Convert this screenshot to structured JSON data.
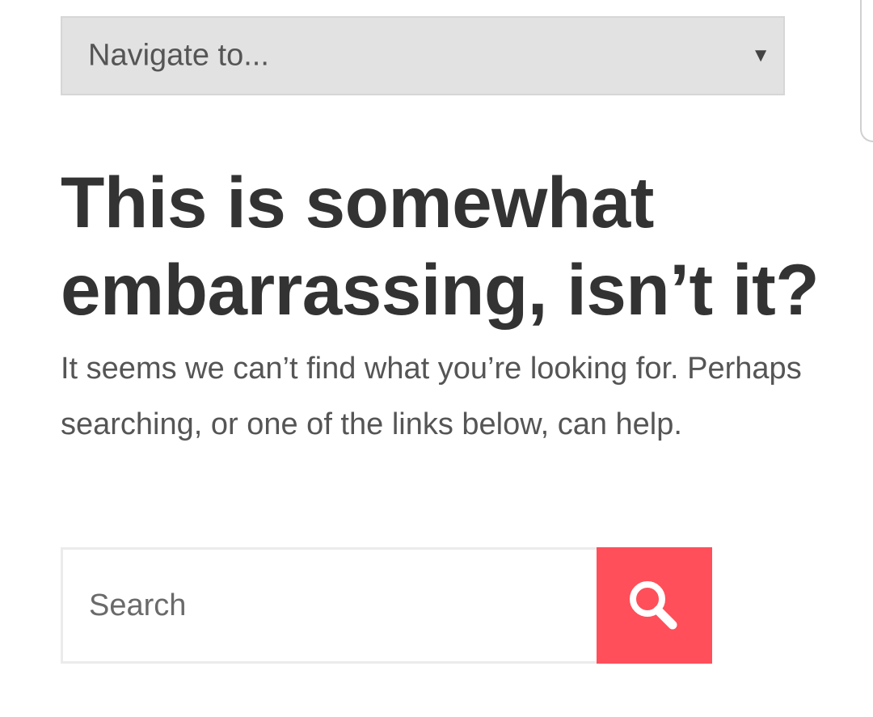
{
  "nav": {
    "select_label": "Navigate to...",
    "arrow_icon": "dropdown-triangle-icon"
  },
  "content": {
    "title": "This is somewhat embarrassing, isn’t it?",
    "message": "It seems we can’t find what you’re looking for. Perhaps searching, or one of the links below, can help."
  },
  "search": {
    "placeholder": "Search",
    "button_icon": "search-icon",
    "button_color": "#ff4f5a"
  },
  "colors": {
    "title": "#333333",
    "body_text": "#555555",
    "select_background": "#e2e2e2"
  }
}
